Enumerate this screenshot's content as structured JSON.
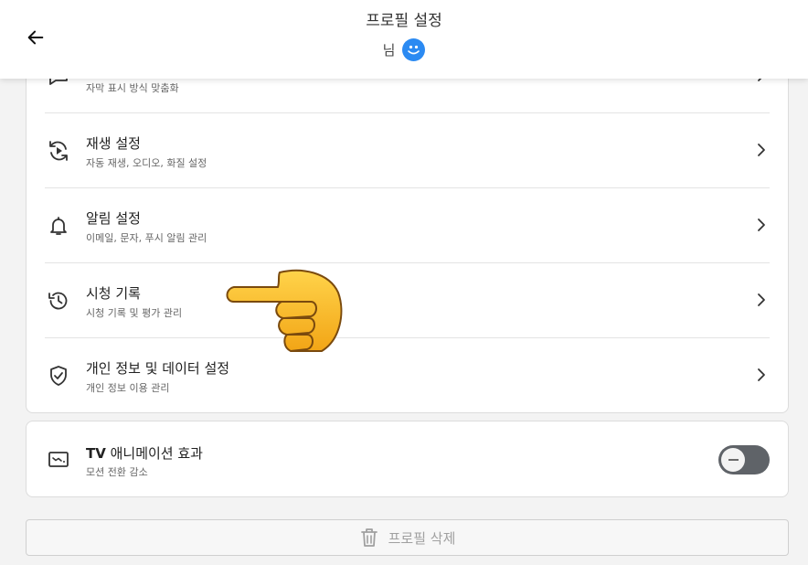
{
  "header": {
    "title": "프로필 설정",
    "user_name": "님"
  },
  "settings": {
    "top_partial": {
      "desc": "자막 표시 방식 맞춤화",
      "icon": "subtitles-icon"
    },
    "items": [
      {
        "label": "재생 설정",
        "desc": "자동 재생, 오디오, 화질 설정",
        "icon": "playback-icon"
      },
      {
        "label": "알림 설정",
        "desc": "이메일, 문자, 푸시 알림 관리",
        "icon": "bell-icon"
      },
      {
        "label": "시청 기록",
        "desc": "시청 기록 및 평가 관리",
        "icon": "history-icon"
      },
      {
        "label": "개인 정보 및 데이터 설정",
        "desc": "개인 정보 이용 관리",
        "icon": "shield-check-icon"
      }
    ]
  },
  "tv_animation": {
    "label_bold": "TV",
    "label_rest": " 애니메이션 효과",
    "desc": "모션 전환 감소",
    "toggle_on": false
  },
  "delete_profile": {
    "label": "프로필 삭제"
  },
  "colors": {
    "accent": "#2b8af2",
    "toggle_track": "#5f6368"
  }
}
